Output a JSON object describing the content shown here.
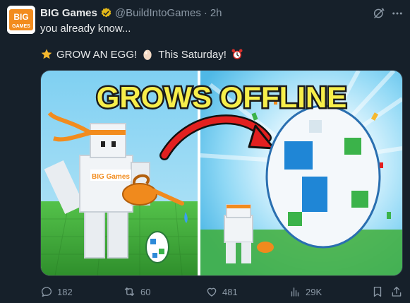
{
  "post": {
    "author_name": "BIG Games",
    "handle": "@BuildIntoGames",
    "separator": "·",
    "time": "2h",
    "text_line1": "you already know...",
    "text_grow": "GROW AN EGG!",
    "text_saturday": "This Saturday!",
    "avatar_text": "BIG GAMES"
  },
  "media": {
    "title": "GROWS OFFLINE",
    "shirt_text": "BIG Games"
  },
  "actions": {
    "replies": "182",
    "reposts": "60",
    "likes": "481",
    "views": "29K"
  },
  "icons": {
    "verified": "verified-badge-icon",
    "grok": "grok-icon",
    "more": "more-icon",
    "reply": "reply-icon",
    "repost": "repost-icon",
    "like": "like-icon",
    "views": "views-icon",
    "bookmark": "bookmark-icon",
    "share": "share-icon"
  },
  "colors": {
    "background": "#16202a",
    "text": "#e7e9ea",
    "muted": "#8b98a5",
    "verified_gold": "#e2b719",
    "brand_orange": "#f28c1e"
  }
}
